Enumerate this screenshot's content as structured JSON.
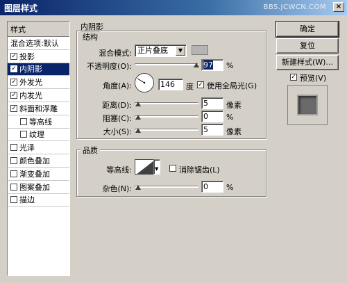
{
  "window": {
    "title": "图层样式",
    "watermark": "BBS.JCWCN.COM",
    "close": "×"
  },
  "left_panel": {
    "header": "样式",
    "items": [
      {
        "label": "混合选项:默认",
        "checkbox": false,
        "checked": false,
        "sub": false,
        "selected": false
      },
      {
        "label": "投影",
        "checkbox": true,
        "checked": true,
        "sub": false,
        "selected": false
      },
      {
        "label": "内阴影",
        "checkbox": true,
        "checked": true,
        "sub": false,
        "selected": true
      },
      {
        "label": "外发光",
        "checkbox": true,
        "checked": true,
        "sub": false,
        "selected": false
      },
      {
        "label": "内发光",
        "checkbox": true,
        "checked": true,
        "sub": false,
        "selected": false
      },
      {
        "label": "斜面和浮雕",
        "checkbox": true,
        "checked": true,
        "sub": false,
        "selected": false
      },
      {
        "label": "等高线",
        "checkbox": true,
        "checked": false,
        "sub": true,
        "selected": false
      },
      {
        "label": "纹理",
        "checkbox": true,
        "checked": false,
        "sub": true,
        "selected": false
      },
      {
        "label": "光泽",
        "checkbox": true,
        "checked": false,
        "sub": false,
        "selected": false
      },
      {
        "label": "颜色叠加",
        "checkbox": true,
        "checked": false,
        "sub": false,
        "selected": false
      },
      {
        "label": "渐变叠加",
        "checkbox": true,
        "checked": false,
        "sub": false,
        "selected": false
      },
      {
        "label": "图案叠加",
        "checkbox": true,
        "checked": false,
        "sub": false,
        "selected": false
      },
      {
        "label": "描边",
        "checkbox": true,
        "checked": false,
        "sub": false,
        "selected": false
      }
    ]
  },
  "panel_title": "内阴影",
  "structure": {
    "title": "结构",
    "blend_mode_label": "混合模式:",
    "blend_mode_value": "正片叠底",
    "opacity_label": "不透明度(O):",
    "opacity_value": "97",
    "opacity_fraction": 0.97,
    "angle_label": "角度(A):",
    "angle_value": "146",
    "angle_unit": "度",
    "global_light_label": "使用全局光(G)",
    "global_light_checked": true,
    "distance_label": "距离(D):",
    "distance_value": "5",
    "choke_label": "阻塞(C):",
    "choke_value": "0",
    "size_label": "大小(S):",
    "size_value": "5",
    "unit_px": "像素",
    "unit_pct": "%"
  },
  "quality": {
    "title": "品质",
    "contour_label": "等高线:",
    "antialias_label": "消除锯齿(L)",
    "antialias_checked": false,
    "noise_label": "杂色(N):",
    "noise_value": "0",
    "unit_pct": "%"
  },
  "buttons": {
    "ok": "确定",
    "reset": "复位",
    "new_style": "新建样式(W)...",
    "preview_label": "预览(V)",
    "preview_checked": true
  }
}
